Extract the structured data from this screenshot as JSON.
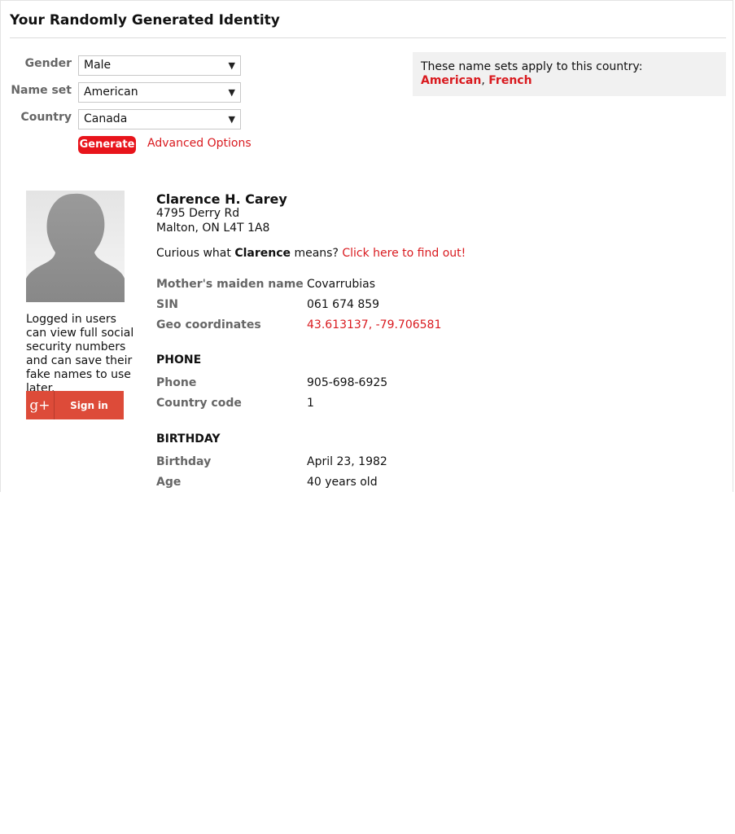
{
  "page_title": "Your Randomly Generated Identity",
  "form": {
    "gender_label": "Gender",
    "gender_value": "Male",
    "nameset_label": "Name set",
    "nameset_value": "American",
    "country_label": "Country",
    "country_value": "Canada",
    "generate_label": "Generate",
    "advanced_label": "Advanced Options"
  },
  "info_box": {
    "text": "These name sets apply to this country:",
    "sets": [
      "American",
      "French"
    ]
  },
  "sidebar": {
    "login_note": "Logged in users can view full social security numbers and can save their fake names to use later.",
    "signin_label": "Sign in",
    "signin_icon": "g+"
  },
  "identity": {
    "name": "Clarence H. Carey",
    "address_line1": "4795 Derry Rd",
    "address_line2": "Malton, ON L4T 1A8",
    "curious_prefix": "Curious what",
    "curious_name": "Clarence",
    "curious_suffix": "means?",
    "curious_link": "Click here to find out!",
    "fields": [
      {
        "label": "Mother's maiden name",
        "value": "Covarrubias"
      },
      {
        "label": "SIN",
        "value": "061 674 859"
      },
      {
        "label": "Geo coordinates",
        "value": "43.613137, -79.706581"
      }
    ],
    "phone_heading": "PHONE",
    "phone_fields": [
      {
        "label": "Phone",
        "value": "905-698-6925"
      },
      {
        "label": "Country code",
        "value": "1"
      }
    ],
    "birthday_heading": "BIRTHDAY",
    "birthday_fields": [
      {
        "label": "Birthday",
        "value": "April 23, 1982"
      },
      {
        "label": "Age",
        "value": "40 years old"
      }
    ]
  },
  "colors": {
    "accent": "#d91a1f",
    "google": "#dd4b39"
  }
}
